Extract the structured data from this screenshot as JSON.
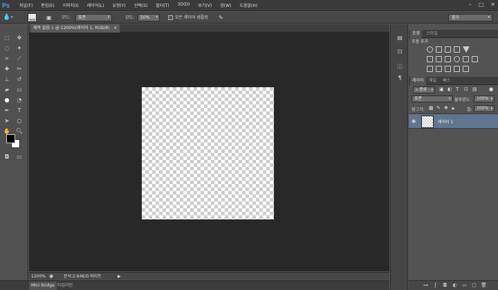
{
  "app": {
    "logo": "Ps"
  },
  "menubar": {
    "items": [
      "파일(F)",
      "편집(E)",
      "이미지(I)",
      "레이어(L)",
      "유형(Y)",
      "선택(S)",
      "필터(T)",
      "3D(D)",
      "보기(V)",
      "창(W)",
      "도움말(H)"
    ],
    "window_buttons": {
      "minimize": "–",
      "maximize": "□",
      "close": "✕"
    }
  },
  "options": {
    "brush_size": "300",
    "mode_label": "모드:",
    "mode_value": "표준",
    "strength_label": "강도:",
    "strength_value": "50%",
    "sample_all_label": "모든 레이어 샘플링",
    "workspace": "필수"
  },
  "document": {
    "tab_title": "제목 없음-1 @ 1200%(레이어 1, RGB/8)",
    "tab_close": "×"
  },
  "status": {
    "zoom": "1200%",
    "doc_info": "문서:2.64K/0 바이트"
  },
  "bottom_tabs": [
    "Mini Bridge",
    "타임라인"
  ],
  "adjust_panel": {
    "tabs": [
      "조정",
      "스타일"
    ],
    "title": "조정 추가"
  },
  "layers_panel": {
    "tabs": [
      "레이어",
      "채널",
      "패스"
    ],
    "filter_label": "종류",
    "blend_mode": "표준",
    "opacity_label": "불투명도:",
    "opacity_value": "100%",
    "lock_label": "잠그기:",
    "fill_label": "칠:",
    "fill_value": "100%",
    "layers": [
      {
        "name": "레이어 1"
      }
    ]
  }
}
